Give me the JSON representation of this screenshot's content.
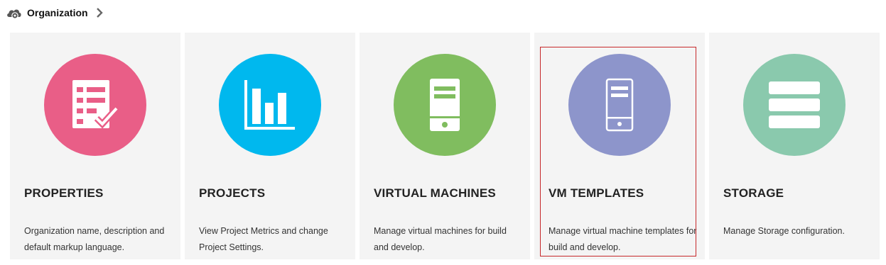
{
  "breadcrumb": {
    "icon": "cloud-gear-icon",
    "label": "Organization",
    "chevron": "chevron-right-icon"
  },
  "cards": [
    {
      "title": "PROPERTIES",
      "description": "Organization name, description and default markup language.",
      "icon": "checklist-icon",
      "color": "#e95e87"
    },
    {
      "title": "PROJECTS",
      "description": "View Project Metrics and change Project Settings.",
      "icon": "bar-chart-icon",
      "color": "#00b8ee"
    },
    {
      "title": "VIRTUAL MACHINES",
      "description": "Manage virtual machines for build and develop.",
      "icon": "server-icon",
      "color": "#80bd5f"
    },
    {
      "title": "VM TEMPLATES",
      "description": "Manage virtual machine templates for build and develop.",
      "icon": "server-outline-icon",
      "color": "#8d95cb",
      "selected_border_color": "#c6282b"
    },
    {
      "title": "STORAGE",
      "description": "Manage Storage configuration.",
      "icon": "storage-stack-icon",
      "color": "#8ac9ad"
    }
  ]
}
